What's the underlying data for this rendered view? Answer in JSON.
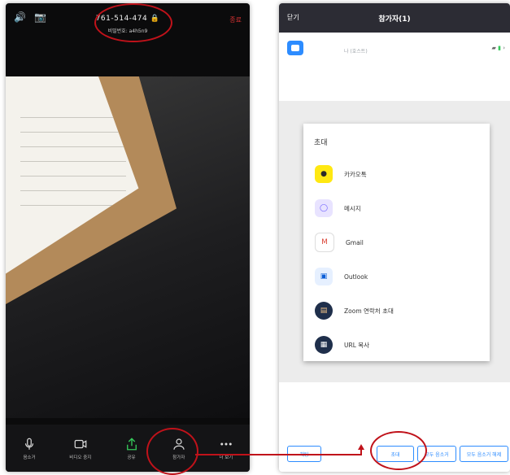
{
  "left_phone": {
    "meeting_id": "761-514-474",
    "meeting_password_line": "비밀번호: a4h5n9",
    "end_label": "종료",
    "toolbar": [
      {
        "label": "음소거",
        "icon": "mic-icon"
      },
      {
        "label": "비디오 중지",
        "icon": "video-icon"
      },
      {
        "label": "공유",
        "icon": "share-icon"
      },
      {
        "label": "참가자",
        "icon": "participants-icon"
      },
      {
        "label": "더 보기",
        "icon": "more-icon"
      }
    ]
  },
  "right_phone": {
    "header": {
      "close_label": "닫기",
      "title": "참가자(1)"
    },
    "participant": {
      "name": "나 (호스트)"
    },
    "invite": {
      "title": "초대",
      "items": [
        {
          "label": "카카오톡",
          "icon": "kakaotalk-icon",
          "bg": "#ffe812",
          "fg": "#2a2a2a"
        },
        {
          "label": "메시지",
          "icon": "message-icon",
          "bg": "#e8e3ff",
          "fg": "#6b5cff"
        },
        {
          "label": "Gmail",
          "icon": "gmail-icon",
          "bg": "#ffffff",
          "fg": "#db4437"
        },
        {
          "label": "Outlook",
          "icon": "outlook-icon",
          "bg": "#e6f0ff",
          "fg": "#0b5ed7"
        },
        {
          "label": "Zoom 연락처 초대",
          "icon": "contacts-icon",
          "bg": "#1f2f4b",
          "fg": "#f3c58a"
        },
        {
          "label": "URL 복사",
          "icon": "link-icon",
          "bg": "#1f2f4b",
          "fg": "#ffffff"
        }
      ]
    },
    "bottom_buttons": {
      "chat": "채팅",
      "invite": "초대",
      "mute_all": "모두 음소거",
      "unmute_all": "모두 음소거 해제"
    }
  },
  "colors": {
    "annotation_red": "#c0121a",
    "zoom_blue": "#2d8cff"
  }
}
